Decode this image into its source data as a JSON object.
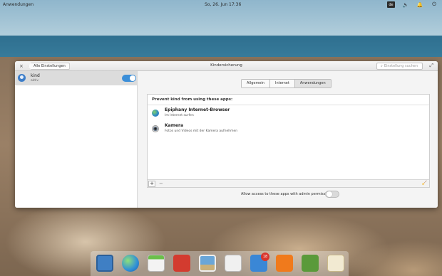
{
  "panel": {
    "applications_label": "Anwendungen",
    "clock": "So, 26. Jun    17:36",
    "tray_icons": [
      "keyboard-icon",
      "volume-icon",
      "bell-icon",
      "power-icon"
    ],
    "keyboard_layout": "de"
  },
  "window": {
    "back_button_label": "Alle Einstellungen",
    "title": "Kindersicherung",
    "search_placeholder": "Einstellung suchen"
  },
  "sidebar": {
    "user": {
      "name": "kind",
      "subtitle": "aktiv",
      "enabled": true
    }
  },
  "tabs": [
    {
      "label": "Allgemein",
      "selected": false
    },
    {
      "label": "Internet",
      "selected": false
    },
    {
      "label": "Anwendungen",
      "selected": true
    }
  ],
  "apps_list": {
    "header": "Prevent kind from using these apps:",
    "items": [
      {
        "name": "Epiphany Internet-Browser",
        "description": "Im Internet surfen",
        "icon": "epiphany-icon"
      },
      {
        "name": "Kamera",
        "description": "Fotos und Videos mit der Kamera aufnehmen",
        "icon": "camera-icon"
      }
    ],
    "add_symbol": "+",
    "remove_symbol": "−",
    "clear_symbol": "🧹"
  },
  "admin": {
    "label": "Allow access to these apps with admin permission:",
    "enabled": false
  },
  "dock": {
    "items": [
      {
        "name": "multitasking-view-icon",
        "color": "#3f7fc4"
      },
      {
        "name": "web-browser-icon",
        "color": "#2f8fd8"
      },
      {
        "name": "calendar-icon",
        "color": "#f3f3f3"
      },
      {
        "name": "videos-icon",
        "color": "#d33b2f"
      },
      {
        "name": "photos-icon",
        "color": "#e6e6e6"
      },
      {
        "name": "system-settings-icon",
        "color": "#f0f0f0"
      },
      {
        "name": "appcenter-icon",
        "color": "#3a87d6",
        "badge": "18"
      },
      {
        "name": "music-icon",
        "color": "#f07a1c"
      },
      {
        "name": "ladybug-icon",
        "color": "#5a9a3a"
      },
      {
        "name": "mail-icon",
        "color": "#f2ead2"
      }
    ]
  }
}
